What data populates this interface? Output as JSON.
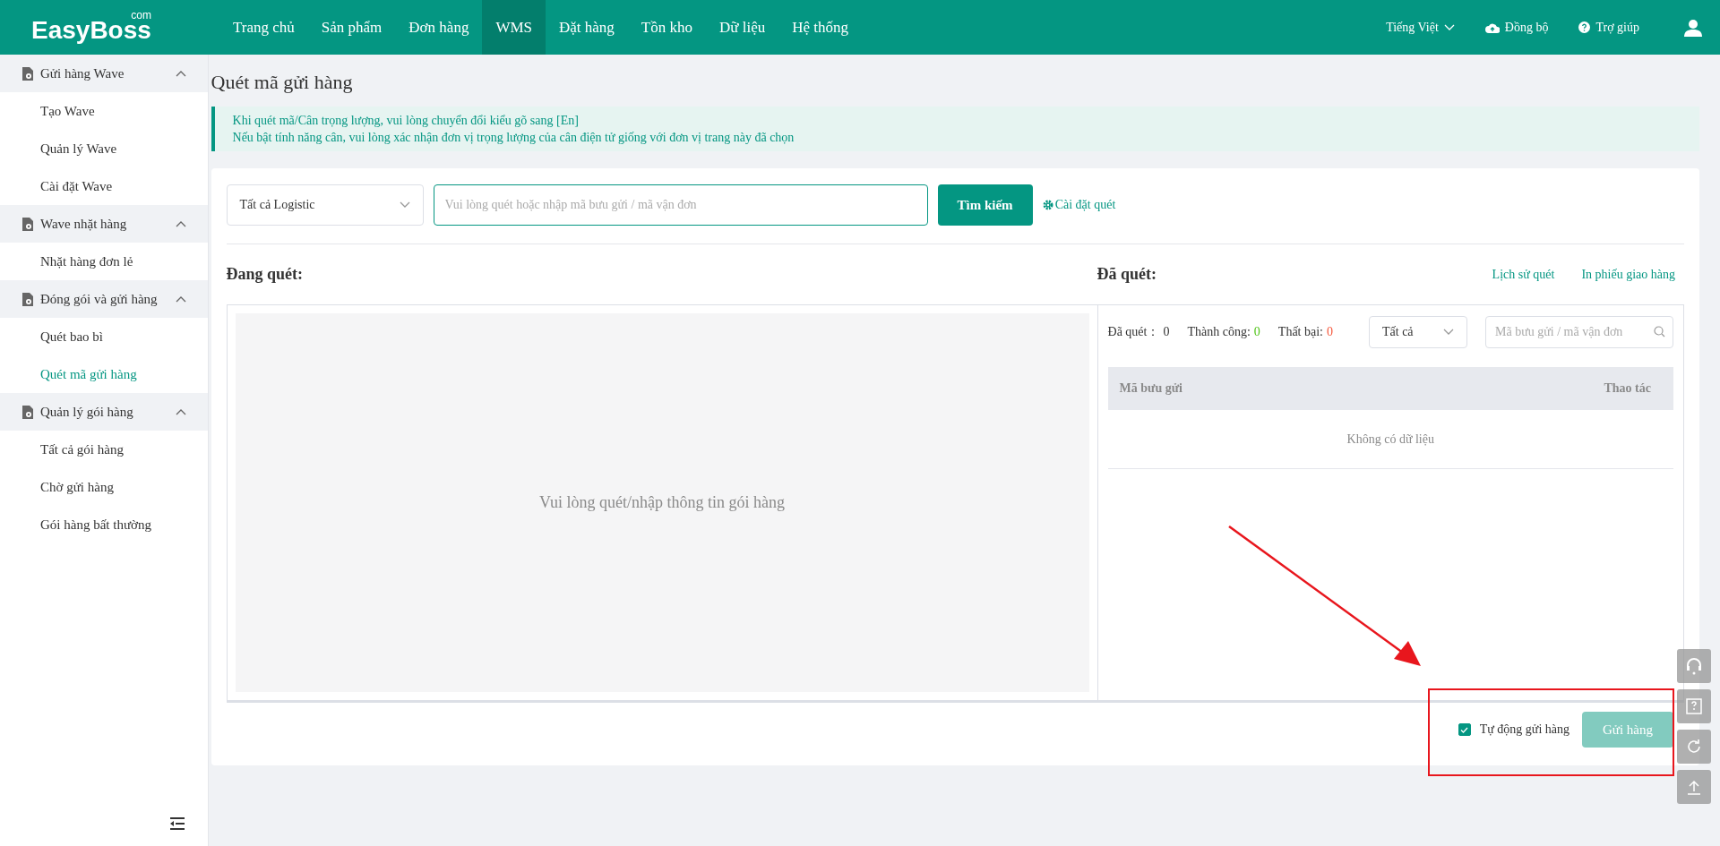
{
  "header": {
    "logo": "EasyBoss",
    "logo_suffix": "com",
    "nav": [
      {
        "label": "Trang chủ",
        "selected": false
      },
      {
        "label": "Sản phẩm",
        "selected": false
      },
      {
        "label": "Đơn hàng",
        "selected": false
      },
      {
        "label": "WMS",
        "selected": true
      },
      {
        "label": "Đặt hàng",
        "selected": false
      },
      {
        "label": "Tồn kho",
        "selected": false
      },
      {
        "label": "Dữ liệu",
        "selected": false
      },
      {
        "label": "Hệ thống",
        "selected": false
      }
    ],
    "language": "Tiếng Việt",
    "sync": "Đồng bộ",
    "help": "Trợ giúp"
  },
  "sidebar": {
    "groups": [
      {
        "label": "Gửi hàng Wave",
        "expanded": true,
        "children": [
          {
            "label": "Tạo Wave",
            "selected": false
          },
          {
            "label": "Quản lý Wave",
            "selected": false
          },
          {
            "label": "Cài đặt Wave",
            "selected": false
          }
        ]
      },
      {
        "label": "Wave nhặt hàng",
        "expanded": true,
        "children": [
          {
            "label": "Nhặt hàng đơn lẻ",
            "selected": false
          }
        ]
      },
      {
        "label": "Đóng gói và gửi hàng",
        "expanded": true,
        "children": [
          {
            "label": "Quét bao bì",
            "selected": false
          },
          {
            "label": "Quét mã gửi hàng",
            "selected": true
          }
        ]
      },
      {
        "label": "Quản lý gói hàng",
        "expanded": true,
        "children": [
          {
            "label": "Tất cả gói hàng",
            "selected": false
          },
          {
            "label": "Chờ gửi hàng",
            "selected": false
          },
          {
            "label": "Gói hàng bất thường",
            "selected": false
          }
        ]
      }
    ]
  },
  "page_title": "Quét mã gửi hàng",
  "notice": [
    "Khi quét mã/Cân trọng lượng, vui lòng chuyển đổi kiểu gõ sang [En]",
    "Nếu bật tính năng cân, vui lòng xác nhận đơn vị trọng lượng của cân điện tử giống với đơn vị trang này đã chọn"
  ],
  "search": {
    "logistics_select": "Tất cả Logistic",
    "placeholder": "Vui lòng quét hoặc nhập mã bưu gửi / mã vận đơn",
    "button": "Tìm kiếm",
    "settings_link": "Cài đặt quét"
  },
  "scanning": {
    "title": "Đang quét:",
    "empty_text": "Vui lòng quét/nhập thông tin gói hàng"
  },
  "scanned": {
    "title": "Đã quét:",
    "links": [
      "Lịch sử quét",
      "In phiếu giao hàng"
    ],
    "stats": [
      {
        "label": "Đã quét：",
        "value": "0",
        "color": "#333333"
      },
      {
        "label": "Thành công:",
        "value": "0",
        "color": "#52c41a"
      },
      {
        "label": "Thất bại:",
        "value": "0",
        "color": "#f5573b"
      }
    ],
    "status_select": "Tất cả",
    "filter_placeholder": "Mã bưu gửi / mã vận đơn",
    "table": {
      "columns": [
        "Mã bưu gửi",
        "Thao tác"
      ],
      "empty_text": "Không có dữ liệu"
    }
  },
  "footer": {
    "auto_send": {
      "label": "Tự động gửi hàng",
      "checked": true
    },
    "send_button": {
      "label": "Gửi hàng",
      "disabled": true
    }
  }
}
